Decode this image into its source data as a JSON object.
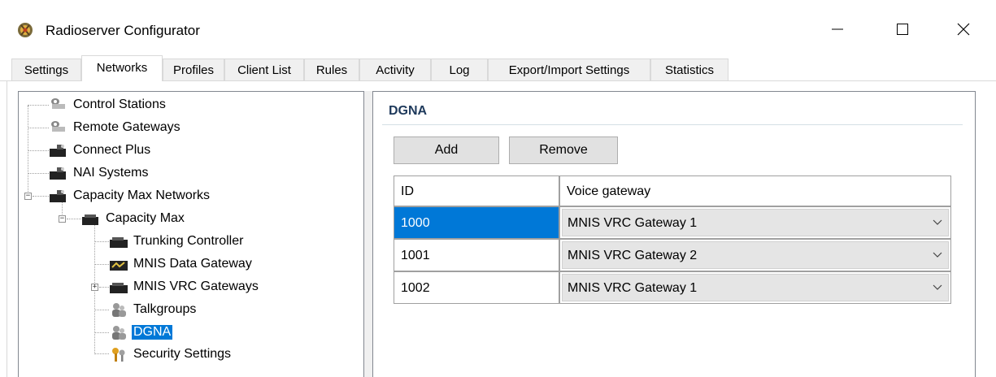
{
  "window": {
    "title": "Radioserver Configurator"
  },
  "tabs": [
    {
      "label": "Settings"
    },
    {
      "label": "Networks"
    },
    {
      "label": "Profiles"
    },
    {
      "label": "Client List"
    },
    {
      "label": "Rules"
    },
    {
      "label": "Activity"
    },
    {
      "label": "Log"
    },
    {
      "label": "Export/Import Settings"
    },
    {
      "label": "Statistics"
    }
  ],
  "active_tab": "Networks",
  "tree": {
    "items": [
      {
        "label": "Control Stations",
        "icon": "gateway-icon"
      },
      {
        "label": "Remote Gateways",
        "icon": "gateway-icon"
      },
      {
        "label": "Connect Plus",
        "icon": "network-icon"
      },
      {
        "label": "NAI Systems",
        "icon": "network-icon"
      },
      {
        "label": "Capacity Max Networks",
        "icon": "network-icon"
      },
      {
        "label": "Capacity Max",
        "icon": "network-icon"
      },
      {
        "label": "Trunking Controller",
        "icon": "device-icon"
      },
      {
        "label": "MNIS Data Gateway",
        "icon": "data-gateway-icon"
      },
      {
        "label": "MNIS VRC Gateways",
        "icon": "device-icon"
      },
      {
        "label": "Talkgroups",
        "icon": "users-icon"
      },
      {
        "label": "DGNA",
        "icon": "users-icon"
      },
      {
        "label": "Security Settings",
        "icon": "keys-icon"
      }
    ],
    "selected": "DGNA"
  },
  "panel": {
    "section_title": "DGNA",
    "add_label": "Add",
    "remove_label": "Remove",
    "columns": [
      "ID",
      "Voice gateway"
    ],
    "rows": [
      {
        "id": "1000",
        "voice_gateway": "MNIS VRC Gateway 1"
      },
      {
        "id": "1001",
        "voice_gateway": "MNIS VRC Gateway 2"
      },
      {
        "id": "1002",
        "voice_gateway": "MNIS VRC Gateway 1"
      }
    ],
    "selected_row": "1000"
  },
  "colors": {
    "selection": "#0078d7",
    "section_title": "#1e395b"
  }
}
